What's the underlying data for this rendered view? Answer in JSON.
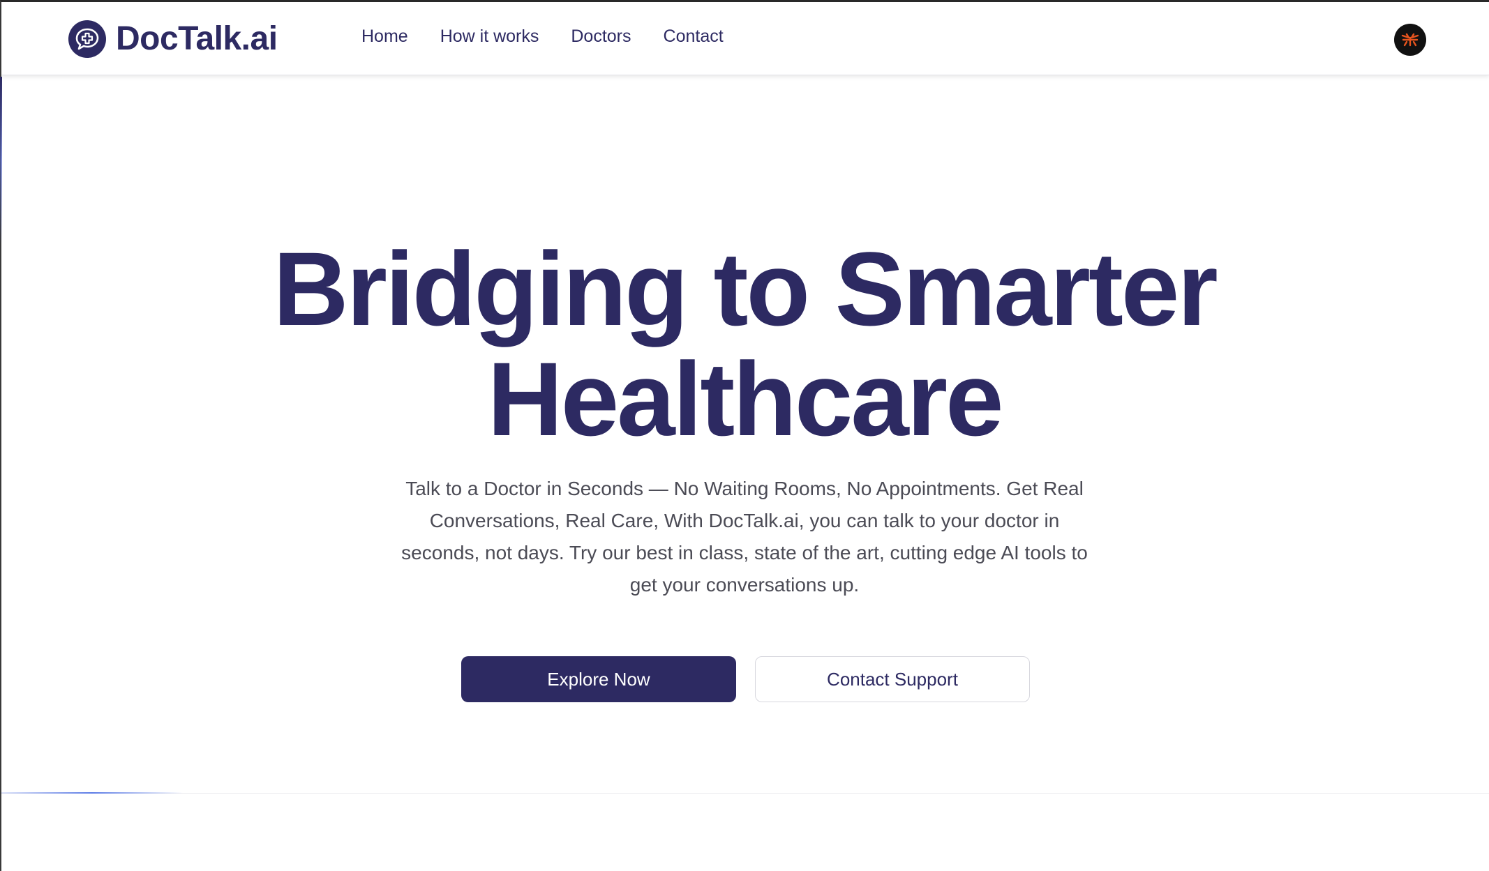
{
  "brand": {
    "name": "DocTalk.ai",
    "logo_icon": "chat-medical-cross-icon"
  },
  "nav": {
    "links": [
      "Home",
      "How it works",
      "Doctors",
      "Contact"
    ]
  },
  "user": {
    "avatar_icon": "user-avatar-icon"
  },
  "hero": {
    "title_line1": "Bridging to Smarter",
    "title_line2": "Healthcare",
    "subtitle": "Talk to a Doctor in Seconds — No Waiting Rooms, No Appointments. Get Real Conversations, Real Care, With DocTalk.ai, you can talk to your doctor in seconds, not days. Try our best in class, state of the art, cutting edge AI tools to get your conversations up.",
    "primary_button": "Explore Now",
    "secondary_button": "Contact Support"
  },
  "colors": {
    "brand": "#2d2a62",
    "text_muted": "#4b4b55",
    "avatar_bg": "#111111",
    "avatar_mark": "#e8541e"
  }
}
